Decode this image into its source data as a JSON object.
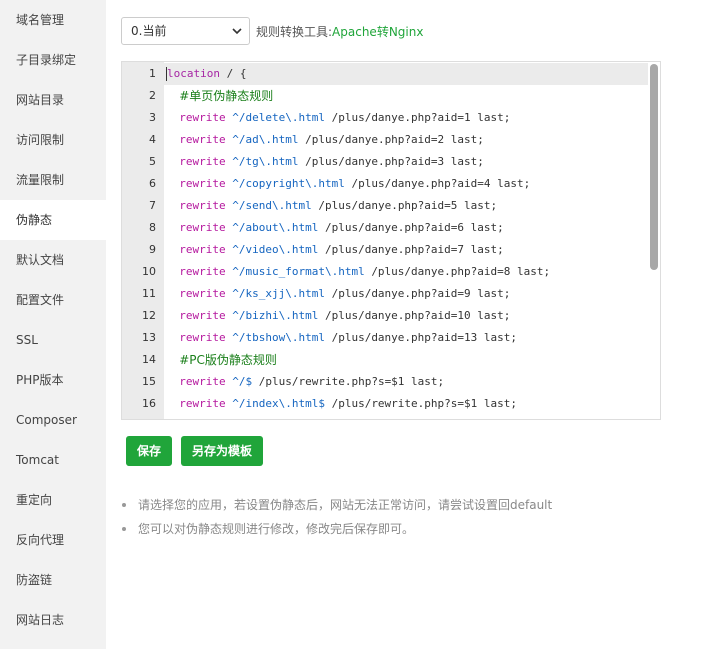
{
  "sidebar": {
    "active_index": 5,
    "items": [
      {
        "label": "域名管理"
      },
      {
        "label": "子目录绑定"
      },
      {
        "label": "网站目录"
      },
      {
        "label": "访问限制"
      },
      {
        "label": "流量限制"
      },
      {
        "label": "伪静态"
      },
      {
        "label": "默认文档"
      },
      {
        "label": "配置文件"
      },
      {
        "label": "SSL"
      },
      {
        "label": "PHP版本"
      },
      {
        "label": "Composer"
      },
      {
        "label": "Tomcat"
      },
      {
        "label": "重定向"
      },
      {
        "label": "反向代理"
      },
      {
        "label": "防盗链"
      },
      {
        "label": "网站日志"
      }
    ]
  },
  "toolbar": {
    "select_value": "0.当前",
    "tool_label": "规则转换工具:",
    "tool_link": "Apache转Nginx"
  },
  "editor": {
    "lines": [
      {
        "num": "1",
        "text": "location / {"
      },
      {
        "num": "2",
        "text": "  #单页伪静态规则"
      },
      {
        "num": "3",
        "text": "  rewrite ^/delete\\.html /plus/danye.php?aid=1 last;"
      },
      {
        "num": "4",
        "text": "  rewrite ^/ad\\.html /plus/danye.php?aid=2 last;"
      },
      {
        "num": "5",
        "text": "  rewrite ^/tg\\.html /plus/danye.php?aid=3 last;"
      },
      {
        "num": "6",
        "text": "  rewrite ^/copyright\\.html /plus/danye.php?aid=4 last;"
      },
      {
        "num": "7",
        "text": "  rewrite ^/send\\.html /plus/danye.php?aid=5 last;"
      },
      {
        "num": "8",
        "text": "  rewrite ^/about\\.html /plus/danye.php?aid=6 last;"
      },
      {
        "num": "9",
        "text": "  rewrite ^/video\\.html /plus/danye.php?aid=7 last;"
      },
      {
        "num": "10",
        "text": "  rewrite ^/music_format\\.html /plus/danye.php?aid=8 last;"
      },
      {
        "num": "11",
        "text": "  rewrite ^/ks_xjj\\.html /plus/danye.php?aid=9 last;"
      },
      {
        "num": "12",
        "text": "  rewrite ^/bizhi\\.html /plus/danye.php?aid=10 last;"
      },
      {
        "num": "13",
        "text": "  rewrite ^/tbshow\\.html /plus/danye.php?aid=13 last;"
      },
      {
        "num": "14",
        "text": "  #PC版伪静态规则"
      },
      {
        "num": "15",
        "text": "  rewrite ^/$ /plus/rewrite.php?s=$1 last;"
      },
      {
        "num": "16",
        "text": "  rewrite ^/index\\.html$ /plus/rewrite.php?s=$1 last;"
      }
    ]
  },
  "buttons": {
    "save": "保存",
    "save_template": "另存为模板"
  },
  "tips": [
    "请选择您的应用，若设置伪静态后，网站无法正常访问，请尝试设置回default",
    "您可以对伪静态规则进行修改，修改完后保存即可。"
  ],
  "colors": {
    "accent": "#20a53a",
    "sidebar_bg": "#f2f2f2",
    "gutter_bg": "#ebebeb"
  },
  "icons": {
    "select_arrow": "chevron-down-icon"
  }
}
